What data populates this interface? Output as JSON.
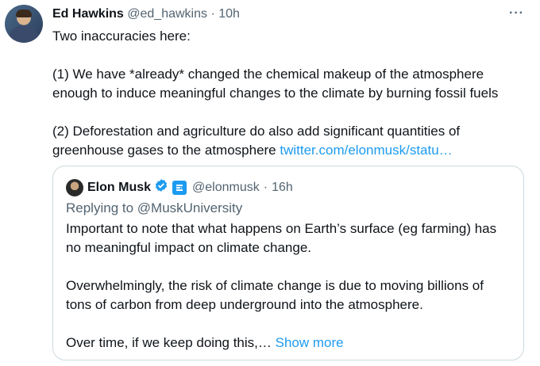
{
  "tweet": {
    "author_name": "Ed Hawkins",
    "author_handle": "@ed_hawkins",
    "separator": "·",
    "time": "10h",
    "paragraphs": [
      "Two inaccuracies here:",
      "(1) We have *already* changed the chemical makeup of the atmosphere enough to induce meaningful changes to the climate by burning fossil fuels",
      "(2) Deforestation and agriculture do also add significant quantities of greenhouse gases to the atmosphere"
    ],
    "link_text": "twitter.com/elonmusk/statu…",
    "more_label": "···"
  },
  "quoted": {
    "author_name": "Elon Musk",
    "author_handle": "@elonmusk",
    "separator": "·",
    "time": "16h",
    "replying_to": "Replying to @MuskUniversity",
    "paragraphs": [
      "Important to note that what happens on Earth’s surface (eg farming) has no meaningful impact on climate change.",
      "Overwhelmingly, the risk of climate change is due to moving billions of tons of carbon from deep underground into the atmosphere.",
      "Over time, if we keep doing this,…"
    ],
    "show_more": "Show more"
  },
  "colors": {
    "accent": "#1d9bf0",
    "text": "#0f1419",
    "secondary": "#536471",
    "border": "#cfd9de"
  },
  "icons": [
    "verified-badge-icon",
    "government-badge-icon",
    "more-options-icon"
  ]
}
